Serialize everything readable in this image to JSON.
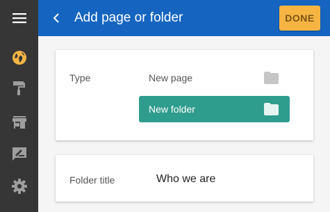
{
  "header": {
    "back_icon": "chevron-left-icon",
    "title": "Add page or folder",
    "done_label": "DONE",
    "color": "#1565c0",
    "done_color": "#f6b543"
  },
  "sidebar": {
    "items": [
      {
        "icon": "menu-icon",
        "active": false
      },
      {
        "icon": "globe-icon",
        "active": true,
        "color": "#f6b543"
      },
      {
        "icon": "paint-roller-icon",
        "active": false
      },
      {
        "icon": "store-icon",
        "active": false
      },
      {
        "icon": "edit-signature-icon",
        "active": false
      },
      {
        "icon": "gear-icon",
        "active": false
      }
    ]
  },
  "type_card": {
    "label": "Type",
    "options": [
      {
        "label": "New page",
        "icon": "folder-icon",
        "selected": false
      },
      {
        "label": "New folder",
        "icon": "folder-icon",
        "selected": true
      }
    ],
    "selected_color": "#2f9d8d"
  },
  "title_card": {
    "label": "Folder title",
    "value": "Who we are"
  }
}
